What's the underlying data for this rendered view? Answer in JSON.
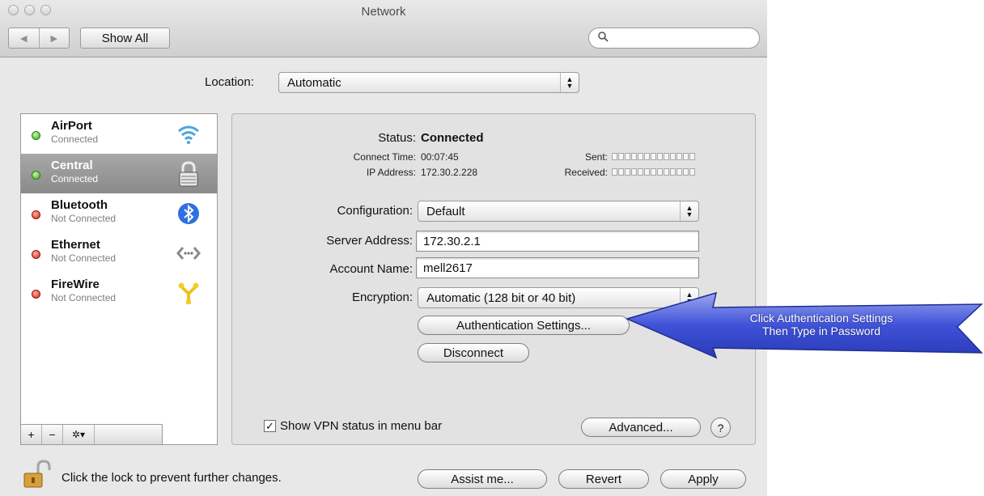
{
  "window": {
    "title": "Network"
  },
  "toolbar": {
    "back_label": "◀",
    "forward_label": "▶",
    "show_all_label": "Show All",
    "search_placeholder": ""
  },
  "location": {
    "label": "Location:",
    "value": "Automatic"
  },
  "services": [
    {
      "name": "AirPort",
      "status": "Connected",
      "indicator": "green",
      "icon": "wifi-icon",
      "selected": false
    },
    {
      "name": "Central",
      "status": "Connected",
      "indicator": "green",
      "icon": "vpn-lock-icon",
      "selected": true
    },
    {
      "name": "Bluetooth",
      "status": "Not Connected",
      "indicator": "red",
      "icon": "bluetooth-icon",
      "selected": false
    },
    {
      "name": "Ethernet",
      "status": "Not Connected",
      "indicator": "red",
      "icon": "ethernet-icon",
      "selected": false
    },
    {
      "name": "FireWire",
      "status": "Not Connected",
      "indicator": "red",
      "icon": "firewire-icon",
      "selected": false
    }
  ],
  "sidebar_tools": {
    "add_label": "+",
    "remove_label": "−",
    "gear_label": "✲▾"
  },
  "detail": {
    "status_label": "Status:",
    "status_value": "Connected",
    "connect_time_label": "Connect Time:",
    "connect_time_value": "00:07:45",
    "ip_label": "IP Address:",
    "ip_value": "172.30.2.228",
    "sent_label": "Sent:",
    "received_label": "Received:",
    "configuration_label": "Configuration:",
    "configuration_value": "Default",
    "server_label": "Server Address:",
    "server_value": "172.30.2.1",
    "account_label": "Account Name:",
    "account_value": "mell2617",
    "encryption_label": "Encryption:",
    "encryption_value": "Automatic (128 bit or 40 bit)",
    "auth_button": "Authentication Settings...",
    "disconnect_button": "Disconnect",
    "show_vpn_label": "Show VPN status in menu bar",
    "show_vpn_checked": true,
    "advanced_button": "Advanced...",
    "help_label": "?"
  },
  "footer": {
    "lock_text": "Click the lock to prevent further changes.",
    "assist_button": "Assist me...",
    "revert_button": "Revert",
    "apply_button": "Apply"
  },
  "callout": {
    "line1": "Click Authentication Settings",
    "line2": "Then Type in Password",
    "color": "#3b4fd6"
  }
}
